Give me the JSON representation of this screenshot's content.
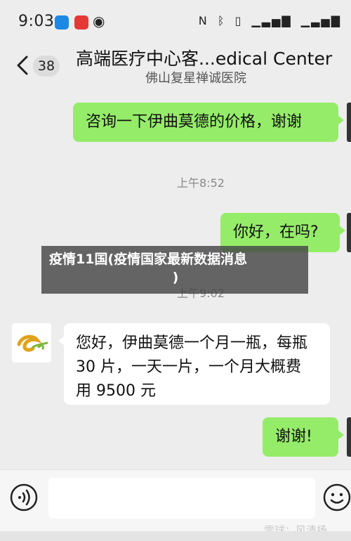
{
  "status_bar": {
    "time": "9:03",
    "icons": [
      "app-icon-blue",
      "app-icon-red",
      "eye-icon",
      "nfc-icon",
      "bluetooth-icon",
      "vibrate-icon",
      "signal-icon",
      "signal-icon"
    ]
  },
  "header": {
    "title": "高端医疗中心客...edical Center",
    "subtitle": "佛山复星禅诚医院",
    "unread_count": "38"
  },
  "messages": [
    {
      "direction": "out",
      "text": "咨询一下伊曲莫德的价格，谢谢"
    },
    {
      "timestamp": "上午8:52"
    },
    {
      "direction": "out",
      "text": "你好，在吗?"
    },
    {
      "timestamp": "上午9:02"
    },
    {
      "direction": "in",
      "lines": [
        "您好，伊曲莫德一个月一瓶，每瓶",
        "30 片，一天一片，一个月大概费",
        "用 9500 元"
      ]
    },
    {
      "direction": "out",
      "text": "谢谢!"
    }
  ],
  "overlay": {
    "line1": "疫情11国(疫情国家最新数据消息",
    "line2": ")"
  },
  "input_bar": {
    "placeholder": ""
  },
  "watermark": "雪球：风清扬",
  "colors": {
    "outgoing_bubble": "#95ec69",
    "incoming_bubble": "#ffffff",
    "background": "#ededed"
  }
}
